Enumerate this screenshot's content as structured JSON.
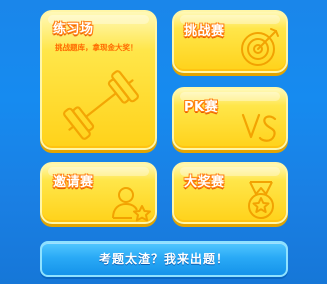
{
  "cards": {
    "practice": {
      "title": "练习场",
      "subtitle": "挑战题库，拿现金大奖！",
      "icon": "dumbbell-icon"
    },
    "challenge": {
      "title": "挑战赛",
      "icon": "target-arrow-icon"
    },
    "pk": {
      "title": "PK赛",
      "icon": "vs-icon"
    },
    "invite": {
      "title": "邀请赛",
      "icon": "user-star-icon"
    },
    "prize": {
      "title": "大奖赛",
      "icon": "medal-icon"
    }
  },
  "bottom_button": {
    "label": "考题太渣？我来出题！"
  },
  "colors": {
    "background": "#168bf0",
    "card_fill": "#ffd21a",
    "title_stroke": "#ff7e11",
    "button_fill": "#2aaaf6"
  }
}
